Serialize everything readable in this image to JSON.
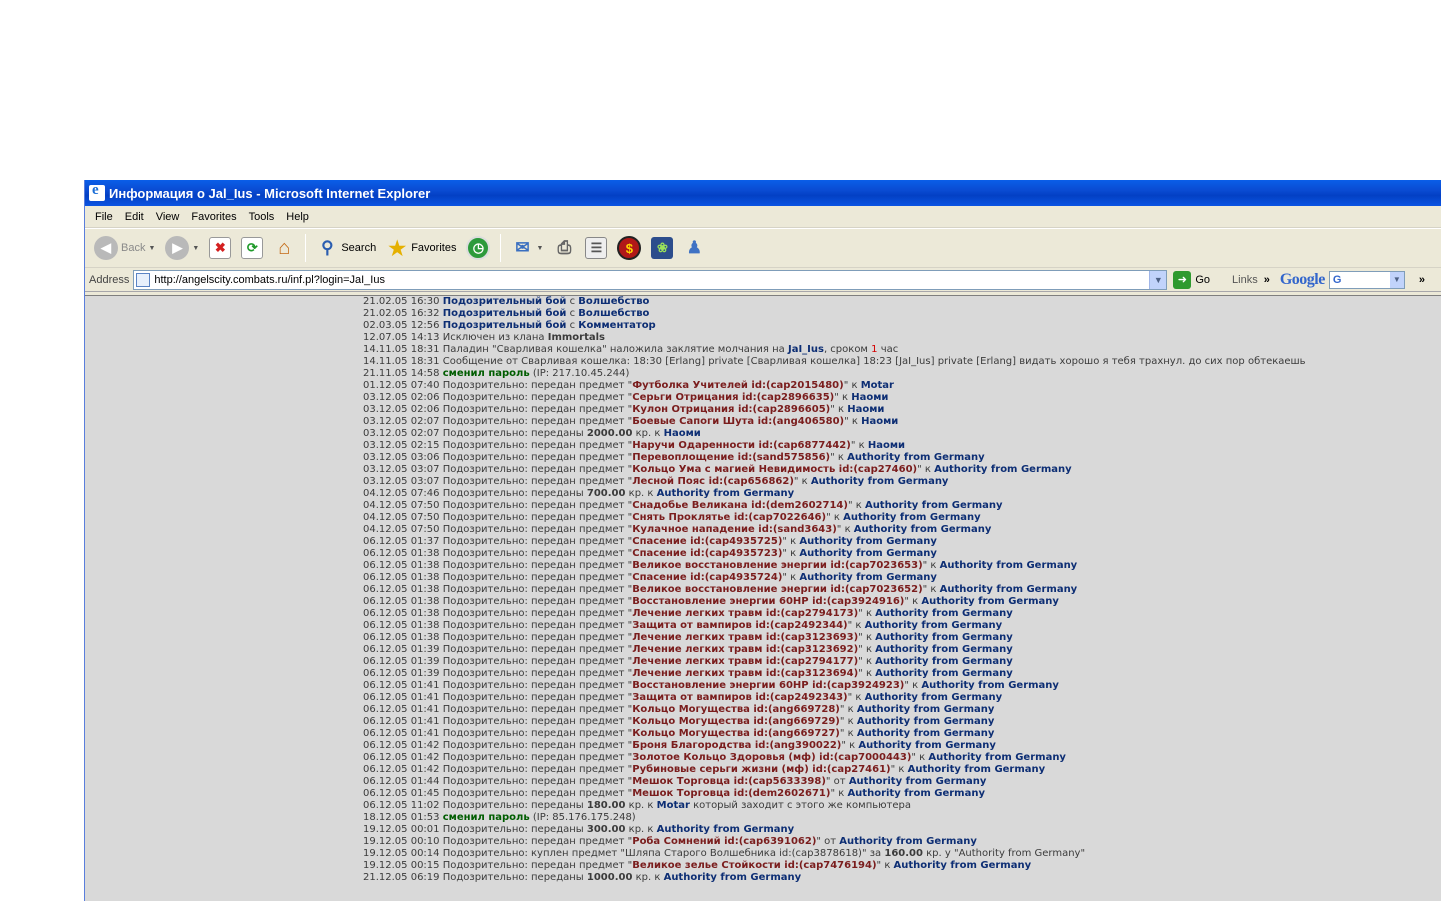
{
  "window": {
    "title": "Информация о Jal_Ius - Microsoft Internet Explorer"
  },
  "menu": [
    "File",
    "Edit",
    "View",
    "Favorites",
    "Tools",
    "Help"
  ],
  "toolbar": {
    "back_label": "Back",
    "search_label": "Search",
    "favorites_label": "Favorites"
  },
  "address": {
    "label": "Address",
    "url": "http://angelscity.combats.ru/inf.pl?login=JaI_Ius",
    "go_label": "Go",
    "links_label": "Links",
    "google_label": "Google"
  },
  "log": [
    {
      "time": "21.02.05 16:30",
      "parts": [
        {
          "t": "Подозрительный бой",
          "c": "nick"
        },
        {
          "t": " с "
        },
        {
          "t": "Волшебство",
          "c": "nick"
        }
      ]
    },
    {
      "time": "21.02.05 16:32",
      "parts": [
        {
          "t": "Подозрительный бой",
          "c": "nick"
        },
        {
          "t": " с "
        },
        {
          "t": "Волшебство",
          "c": "nick"
        }
      ]
    },
    {
      "time": "02.03.05 12:56",
      "parts": [
        {
          "t": "Подозрительный бой",
          "c": "nick"
        },
        {
          "t": " с "
        },
        {
          "t": "Комментатор",
          "c": "nick"
        }
      ]
    },
    {
      "time": "12.07.05 14:13",
      "parts": [
        {
          "t": "Исключен из клана "
        },
        {
          "t": "Immortals",
          "c": "b"
        }
      ]
    },
    {
      "time": "14.11.05 18:31",
      "parts": [
        {
          "t": "Паладин \"Сварливая кошелка\" наложила заклятие молчания на "
        },
        {
          "t": "JaI_Ius",
          "c": "nick"
        },
        {
          "t": ", сроком "
        },
        {
          "t": "1",
          "c": "red"
        },
        {
          "t": " час"
        }
      ]
    },
    {
      "time": "14.11.05 18:31",
      "wrap": true,
      "parts": [
        {
          "t": "Сообщение от Сварливая кошелка: 18:30 [Erlang] private [Сварливая кошелка] 18:23 [JaI_Ius] private [Erlang] видать хорошо я тебя трахнул. до сих пор обтекаешь"
        }
      ]
    },
    {
      "time": "21.11.05 14:58",
      "parts": [
        {
          "t": "сменил пароль",
          "c": "green"
        },
        {
          "t": " (IP: 217.10.45.244)"
        }
      ]
    },
    {
      "time": "01.12.05 07:40",
      "parts": [
        {
          "t": "Подозрительно: передан предмет \""
        },
        {
          "t": "Футболка Учителей id:(cap2015480)",
          "c": "item"
        },
        {
          "t": "\" к "
        },
        {
          "t": "Motar",
          "c": "nick"
        }
      ]
    },
    {
      "time": "03.12.05 02:06",
      "parts": [
        {
          "t": "Подозрительно: передан предмет \""
        },
        {
          "t": "Серьги Отрицания id:(cap2896635)",
          "c": "item"
        },
        {
          "t": "\" к "
        },
        {
          "t": "Наоми",
          "c": "nick"
        }
      ]
    },
    {
      "time": "03.12.05 02:06",
      "parts": [
        {
          "t": "Подозрительно: передан предмет \""
        },
        {
          "t": "Кулон Отрицания id:(cap2896605)",
          "c": "item"
        },
        {
          "t": "\" к "
        },
        {
          "t": "Наоми",
          "c": "nick"
        }
      ]
    },
    {
      "time": "03.12.05 02:07",
      "parts": [
        {
          "t": "Подозрительно: передан предмет \""
        },
        {
          "t": "Боевые Сапоги Шута id:(ang406580)",
          "c": "item"
        },
        {
          "t": "\" к "
        },
        {
          "t": "Наоми",
          "c": "nick"
        }
      ]
    },
    {
      "time": "03.12.05 02:07",
      "parts": [
        {
          "t": "Подозрительно: переданы "
        },
        {
          "t": "2000.00",
          "c": "b"
        },
        {
          "t": " кр. к "
        },
        {
          "t": "Наоми",
          "c": "nick"
        }
      ]
    },
    {
      "time": "03.12.05 02:15",
      "parts": [
        {
          "t": "Подозрительно: передан предмет \""
        },
        {
          "t": "Наручи Одаренности id:(cap6877442)",
          "c": "item"
        },
        {
          "t": "\" к "
        },
        {
          "t": "Наоми",
          "c": "nick"
        }
      ]
    },
    {
      "time": "03.12.05 03:06",
      "parts": [
        {
          "t": "Подозрительно: передан предмет \""
        },
        {
          "t": "Перевоплощение id:(sand575856)",
          "c": "item"
        },
        {
          "t": "\" к "
        },
        {
          "t": "Authority from Germany",
          "c": "nick"
        }
      ]
    },
    {
      "time": "03.12.05 03:07",
      "parts": [
        {
          "t": "Подозрительно: передан предмет \""
        },
        {
          "t": "Кольцо Ума с магией Невидимость id:(cap27460)",
          "c": "item"
        },
        {
          "t": "\" к "
        },
        {
          "t": "Authority from Germany",
          "c": "nick"
        }
      ]
    },
    {
      "time": "03.12.05 03:07",
      "parts": [
        {
          "t": "Подозрительно: передан предмет \""
        },
        {
          "t": "Лесной Пояс id:(cap656862)",
          "c": "item"
        },
        {
          "t": "\" к "
        },
        {
          "t": "Authority from Germany",
          "c": "nick"
        }
      ]
    },
    {
      "time": "04.12.05 07:46",
      "parts": [
        {
          "t": "Подозрительно: переданы "
        },
        {
          "t": "700.00",
          "c": "b"
        },
        {
          "t": " кр. к "
        },
        {
          "t": "Authority from Germany",
          "c": "nick"
        }
      ]
    },
    {
      "time": "04.12.05 07:50",
      "parts": [
        {
          "t": "Подозрительно: передан предмет \""
        },
        {
          "t": "Снадобье Великана id:(dem2602714)",
          "c": "item"
        },
        {
          "t": "\" к "
        },
        {
          "t": "Authority from Germany",
          "c": "nick"
        }
      ]
    },
    {
      "time": "04.12.05 07:50",
      "parts": [
        {
          "t": "Подозрительно: передан предмет \""
        },
        {
          "t": "Снять Проклятье id:(cap7022646)",
          "c": "item"
        },
        {
          "t": "\" к "
        },
        {
          "t": "Authority from Germany",
          "c": "nick"
        }
      ]
    },
    {
      "time": "04.12.05 07:50",
      "parts": [
        {
          "t": "Подозрительно: передан предмет \""
        },
        {
          "t": "Кулачное нападение id:(sand3643)",
          "c": "item"
        },
        {
          "t": "\" к "
        },
        {
          "t": "Authority from Germany",
          "c": "nick"
        }
      ]
    },
    {
      "time": "06.12.05 01:37",
      "parts": [
        {
          "t": "Подозрительно: передан предмет \""
        },
        {
          "t": "Спасение id:(cap4935725)",
          "c": "item"
        },
        {
          "t": "\" к "
        },
        {
          "t": "Authority from Germany",
          "c": "nick"
        }
      ]
    },
    {
      "time": "06.12.05 01:38",
      "parts": [
        {
          "t": "Подозрительно: передан предмет \""
        },
        {
          "t": "Спасение id:(cap4935723)",
          "c": "item"
        },
        {
          "t": "\" к "
        },
        {
          "t": "Authority from Germany",
          "c": "nick"
        }
      ]
    },
    {
      "time": "06.12.05 01:38",
      "parts": [
        {
          "t": "Подозрительно: передан предмет \""
        },
        {
          "t": "Великое восстановление энергии id:(cap7023653)",
          "c": "item"
        },
        {
          "t": "\" к "
        },
        {
          "t": "Authority from Germany",
          "c": "nick"
        }
      ]
    },
    {
      "time": "06.12.05 01:38",
      "parts": [
        {
          "t": "Подозрительно: передан предмет \""
        },
        {
          "t": "Спасение id:(cap4935724)",
          "c": "item"
        },
        {
          "t": "\" к "
        },
        {
          "t": "Authority from Germany",
          "c": "nick"
        }
      ]
    },
    {
      "time": "06.12.05 01:38",
      "parts": [
        {
          "t": "Подозрительно: передан предмет \""
        },
        {
          "t": "Великое восстановление энергии id:(cap7023652)",
          "c": "item"
        },
        {
          "t": "\" к "
        },
        {
          "t": "Authority from Germany",
          "c": "nick"
        }
      ]
    },
    {
      "time": "06.12.05 01:38",
      "parts": [
        {
          "t": "Подозрительно: передан предмет \""
        },
        {
          "t": "Восстановление энергии 60HP id:(cap3924916)",
          "c": "item"
        },
        {
          "t": "\" к "
        },
        {
          "t": "Authority from Germany",
          "c": "nick"
        }
      ]
    },
    {
      "time": "06.12.05 01:38",
      "parts": [
        {
          "t": "Подозрительно: передан предмет \""
        },
        {
          "t": "Лечение легких травм id:(cap2794173)",
          "c": "item"
        },
        {
          "t": "\" к "
        },
        {
          "t": "Authority from Germany",
          "c": "nick"
        }
      ]
    },
    {
      "time": "06.12.05 01:38",
      "parts": [
        {
          "t": "Подозрительно: передан предмет \""
        },
        {
          "t": "Защита от вампиров id:(cap2492344)",
          "c": "item"
        },
        {
          "t": "\" к "
        },
        {
          "t": "Authority from Germany",
          "c": "nick"
        }
      ]
    },
    {
      "time": "06.12.05 01:38",
      "parts": [
        {
          "t": "Подозрительно: передан предмет \""
        },
        {
          "t": "Лечение легких травм id:(cap3123693)",
          "c": "item"
        },
        {
          "t": "\" к "
        },
        {
          "t": "Authority from Germany",
          "c": "nick"
        }
      ]
    },
    {
      "time": "06.12.05 01:39",
      "parts": [
        {
          "t": "Подозрительно: передан предмет \""
        },
        {
          "t": "Лечение легких травм id:(cap3123692)",
          "c": "item"
        },
        {
          "t": "\" к "
        },
        {
          "t": "Authority from Germany",
          "c": "nick"
        }
      ]
    },
    {
      "time": "06.12.05 01:39",
      "parts": [
        {
          "t": "Подозрительно: передан предмет \""
        },
        {
          "t": "Лечение легких травм id:(cap2794177)",
          "c": "item"
        },
        {
          "t": "\" к "
        },
        {
          "t": "Authority from Germany",
          "c": "nick"
        }
      ]
    },
    {
      "time": "06.12.05 01:39",
      "parts": [
        {
          "t": "Подозрительно: передан предмет \""
        },
        {
          "t": "Лечение легких травм id:(cap3123694)",
          "c": "item"
        },
        {
          "t": "\" к "
        },
        {
          "t": "Authority from Germany",
          "c": "nick"
        }
      ]
    },
    {
      "time": "06.12.05 01:41",
      "parts": [
        {
          "t": "Подозрительно: передан предмет \""
        },
        {
          "t": "Восстановление энергии 60HP id:(cap3924923)",
          "c": "item"
        },
        {
          "t": "\" к "
        },
        {
          "t": "Authority from Germany",
          "c": "nick"
        }
      ]
    },
    {
      "time": "06.12.05 01:41",
      "parts": [
        {
          "t": "Подозрительно: передан предмет \""
        },
        {
          "t": "Защита от вампиров id:(cap2492343)",
          "c": "item"
        },
        {
          "t": "\" к "
        },
        {
          "t": "Authority from Germany",
          "c": "nick"
        }
      ]
    },
    {
      "time": "06.12.05 01:41",
      "parts": [
        {
          "t": "Подозрительно: передан предмет \""
        },
        {
          "t": "Кольцо Могущества id:(ang669728)",
          "c": "item"
        },
        {
          "t": "\" к "
        },
        {
          "t": "Authority from Germany",
          "c": "nick"
        }
      ]
    },
    {
      "time": "06.12.05 01:41",
      "parts": [
        {
          "t": "Подозрительно: передан предмет \""
        },
        {
          "t": "Кольцо Могущества id:(ang669729)",
          "c": "item"
        },
        {
          "t": "\" к "
        },
        {
          "t": "Authority from Germany",
          "c": "nick"
        }
      ]
    },
    {
      "time": "06.12.05 01:41",
      "parts": [
        {
          "t": "Подозрительно: передан предмет \""
        },
        {
          "t": "Кольцо Могущества id:(ang669727)",
          "c": "item"
        },
        {
          "t": "\" к "
        },
        {
          "t": "Authority from Germany",
          "c": "nick"
        }
      ]
    },
    {
      "time": "06.12.05 01:42",
      "parts": [
        {
          "t": "Подозрительно: передан предмет \""
        },
        {
          "t": "Броня Благородства id:(ang390022)",
          "c": "item"
        },
        {
          "t": "\" к "
        },
        {
          "t": "Authority from Germany",
          "c": "nick"
        }
      ]
    },
    {
      "time": "06.12.05 01:42",
      "parts": [
        {
          "t": "Подозрительно: передан предмет \""
        },
        {
          "t": "Золотое Кольцо Здоровья (мф) id:(cap7000443)",
          "c": "item"
        },
        {
          "t": "\" к "
        },
        {
          "t": "Authority from Germany",
          "c": "nick"
        }
      ]
    },
    {
      "time": "06.12.05 01:42",
      "parts": [
        {
          "t": "Подозрительно: передан предмет \""
        },
        {
          "t": "Рубиновые серьги жизни (мф) id:(cap27461)",
          "c": "item"
        },
        {
          "t": "\" к "
        },
        {
          "t": "Authority from Germany",
          "c": "nick"
        }
      ]
    },
    {
      "time": "06.12.05 01:44",
      "parts": [
        {
          "t": "Подозрительно: передан предмет \""
        },
        {
          "t": "Мешок Торговца id:(cap5633398)",
          "c": "item"
        },
        {
          "t": "\" от "
        },
        {
          "t": "Authority from Germany",
          "c": "nick"
        }
      ]
    },
    {
      "time": "06.12.05 01:45",
      "parts": [
        {
          "t": "Подозрительно: передан предмет \""
        },
        {
          "t": "Мешок Торговца id:(dem2602671)",
          "c": "item"
        },
        {
          "t": "\" к "
        },
        {
          "t": "Authority from Germany",
          "c": "nick"
        }
      ]
    },
    {
      "time": "06.12.05 11:02",
      "parts": [
        {
          "t": "Подозрительно: переданы "
        },
        {
          "t": "180.00",
          "c": "b"
        },
        {
          "t": " кр. к "
        },
        {
          "t": "Motar",
          "c": "nick"
        },
        {
          "t": " который заходит с этого же компьютера"
        }
      ]
    },
    {
      "time": "18.12.05 01:53",
      "parts": [
        {
          "t": "сменил пароль",
          "c": "green"
        },
        {
          "t": " (IP: 85.176.175.248)"
        }
      ]
    },
    {
      "time": "19.12.05 00:01",
      "parts": [
        {
          "t": "Подозрительно: переданы "
        },
        {
          "t": "300.00",
          "c": "b"
        },
        {
          "t": " кр. к "
        },
        {
          "t": "Authority from Germany",
          "c": "nick"
        }
      ]
    },
    {
      "time": "19.12.05 00:10",
      "parts": [
        {
          "t": "Подозрительно: передан предмет \""
        },
        {
          "t": "Роба Сомнений id:(cap6391062)",
          "c": "item"
        },
        {
          "t": "\" от "
        },
        {
          "t": "Authority from Germany",
          "c": "nick"
        }
      ]
    },
    {
      "time": "19.12.05 00:14",
      "parts": [
        {
          "t": "Подозрительно: куплен предмет \"Шляпа Старого Волшебника id:(cap3878618)\" за "
        },
        {
          "t": "160.00",
          "c": "b"
        },
        {
          "t": " кр. у \"Authority from Germany\""
        }
      ]
    },
    {
      "time": "19.12.05 00:15",
      "parts": [
        {
          "t": "Подозрительно: передан предмет \""
        },
        {
          "t": "Великое зелье Стойкости id:(cap7476194)",
          "c": "item"
        },
        {
          "t": "\" к "
        },
        {
          "t": "Authority from Germany",
          "c": "nick"
        }
      ]
    },
    {
      "time": "21.12.05 06:19",
      "parts": [
        {
          "t": "Подозрительно: переданы "
        },
        {
          "t": "1000.00",
          "c": "b"
        },
        {
          "t": " кр. к "
        },
        {
          "t": "Authority from Germany",
          "c": "nick"
        }
      ]
    }
  ]
}
